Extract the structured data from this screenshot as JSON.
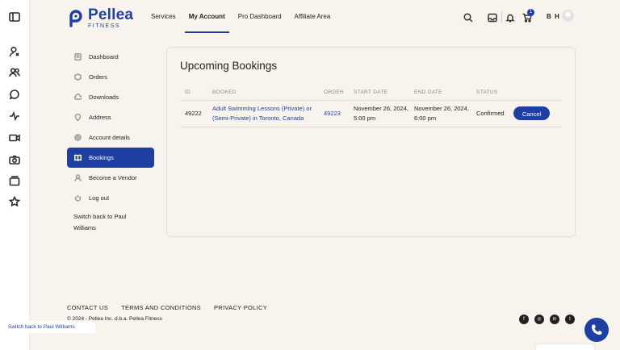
{
  "brand": {
    "name": "Pellea",
    "tagline": "FITNESS",
    "color": "#1f3fa3"
  },
  "nav": {
    "items": [
      "Services",
      "My Account",
      "Pro Dashboard",
      "Affiliate Area"
    ],
    "active": "My Account"
  },
  "header": {
    "cart_count": "1",
    "user_initials": "B H",
    "icons": [
      "search-icon",
      "inbox-icon",
      "bell-icon",
      "cart-icon"
    ]
  },
  "left_toolbar": {
    "icons": [
      "sidebar-toggle-icon",
      "user-icon",
      "users-icon",
      "chat-icon",
      "activity-icon",
      "video-icon",
      "camera-icon",
      "cards-icon",
      "star-icon"
    ]
  },
  "account_menu": {
    "items": [
      "Dashboard",
      "Orders",
      "Downloads",
      "Address",
      "Account details",
      "Bookings",
      "Become a Vendor",
      "Log out"
    ],
    "active": "Bookings",
    "switch_back": "Switch back to Paul Williams"
  },
  "bookings": {
    "title": "Upcoming Bookings",
    "columns": [
      "ID",
      "BOOKED",
      "ORDER",
      "START DATE",
      "END DATE",
      "STATUS"
    ],
    "rows": [
      {
        "id": "49222",
        "booked": "Adult Swimming Lessons (Private) or (Semi-Private) in Toronto, Canada",
        "order": "49223",
        "start": "November 26, 2024, 5:00 pm",
        "end": "November 26, 2024, 6:00 pm",
        "status": "Confirmed",
        "action": "Cancel"
      }
    ]
  },
  "footer": {
    "links": [
      "CONTACT US",
      "TERMS AND CONDITIONS",
      "PRIVACY POLICY"
    ],
    "copyright": "© 2024 - Pellea Inc. d.b.a. Pellea Fitness",
    "social": [
      "facebook-icon",
      "instagram-icon",
      "linkedin-icon",
      "twitter-icon"
    ]
  },
  "floating": {
    "switch_back": "Switch back to Paul Williams"
  }
}
